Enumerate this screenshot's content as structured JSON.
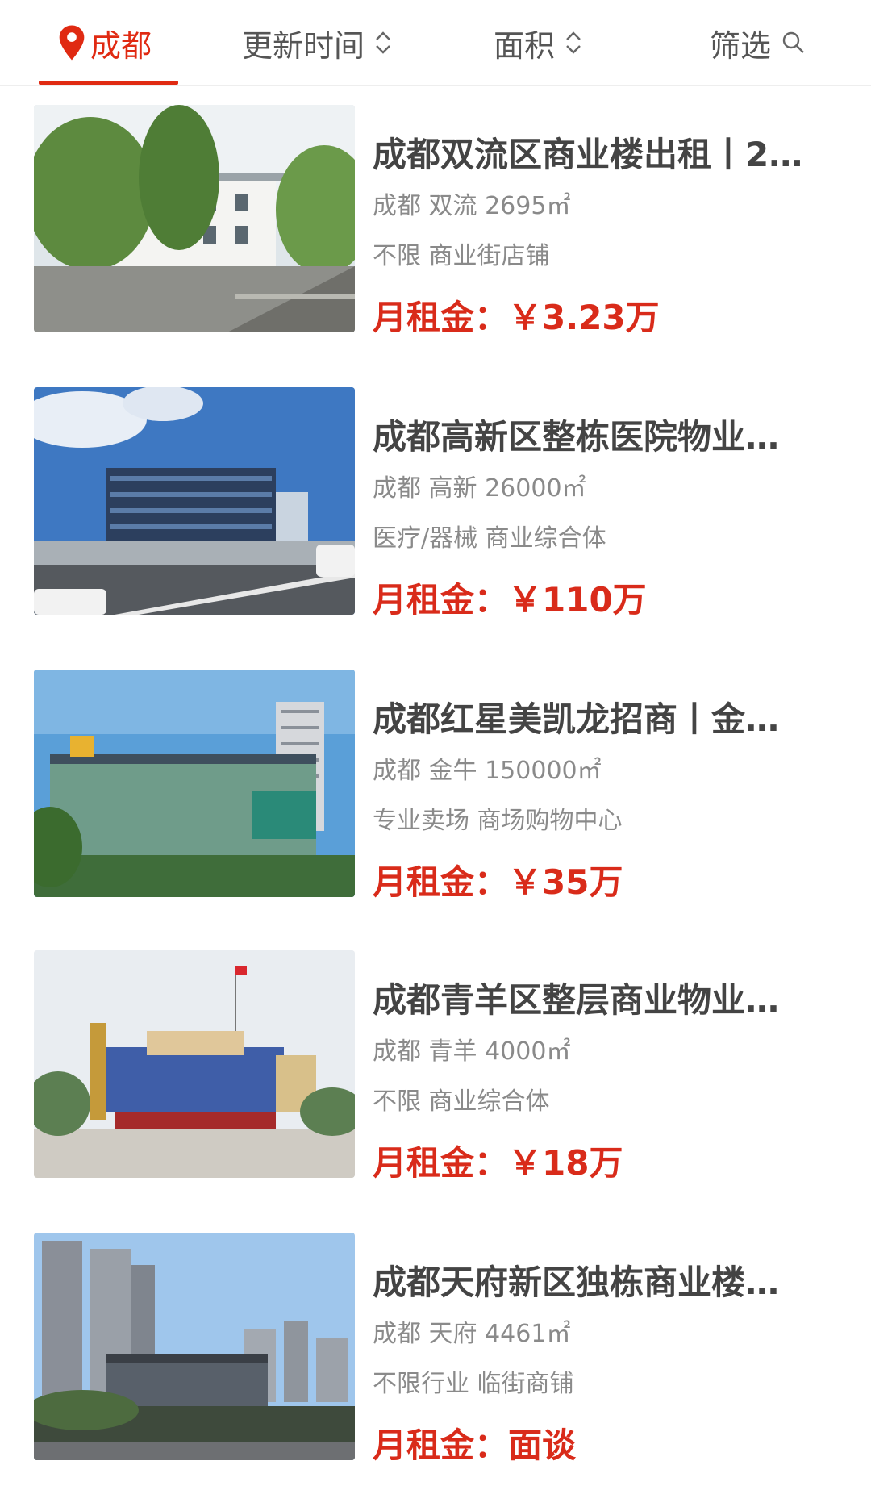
{
  "filter_bar": {
    "city": "成都",
    "update_time": "更新时间",
    "area": "面积",
    "filter": "筛选"
  },
  "listings": [
    {
      "title": "成都双流区商业楼出租丨2…",
      "city": "成都",
      "district": "双流",
      "area": "2695㎡",
      "industry": "不限",
      "type": "商业街店铺",
      "price_label": "月租金：",
      "price": "￥3.23万"
    },
    {
      "title": "成都高新区整栋医院物业…",
      "city": "成都",
      "district": "高新",
      "area": "26000㎡",
      "industry": "医疗/器械",
      "type": "商业综合体",
      "price_label": "月租金：",
      "price": "￥110万"
    },
    {
      "title": "成都红星美凯龙招商丨金…",
      "city": "成都",
      "district": "金牛",
      "area": "150000㎡",
      "industry": "专业卖场",
      "type": "商场购物中心",
      "price_label": "月租金：",
      "price": "￥35万"
    },
    {
      "title": "成都青羊区整层商业物业…",
      "city": "成都",
      "district": "青羊",
      "area": "4000㎡",
      "industry": "不限",
      "type": "商业综合体",
      "price_label": "月租金：",
      "price": "￥18万"
    },
    {
      "title": "成都天府新区独栋商业楼…",
      "city": "成都",
      "district": "天府",
      "area": "4461㎡",
      "industry": "不限行业",
      "type": "临街商铺",
      "price_label": "月租金：",
      "price": "面谈"
    }
  ],
  "colors": {
    "accent": "#e02a12",
    "price": "#d92b1a",
    "title": "#444444",
    "meta": "#8a8a8a"
  }
}
